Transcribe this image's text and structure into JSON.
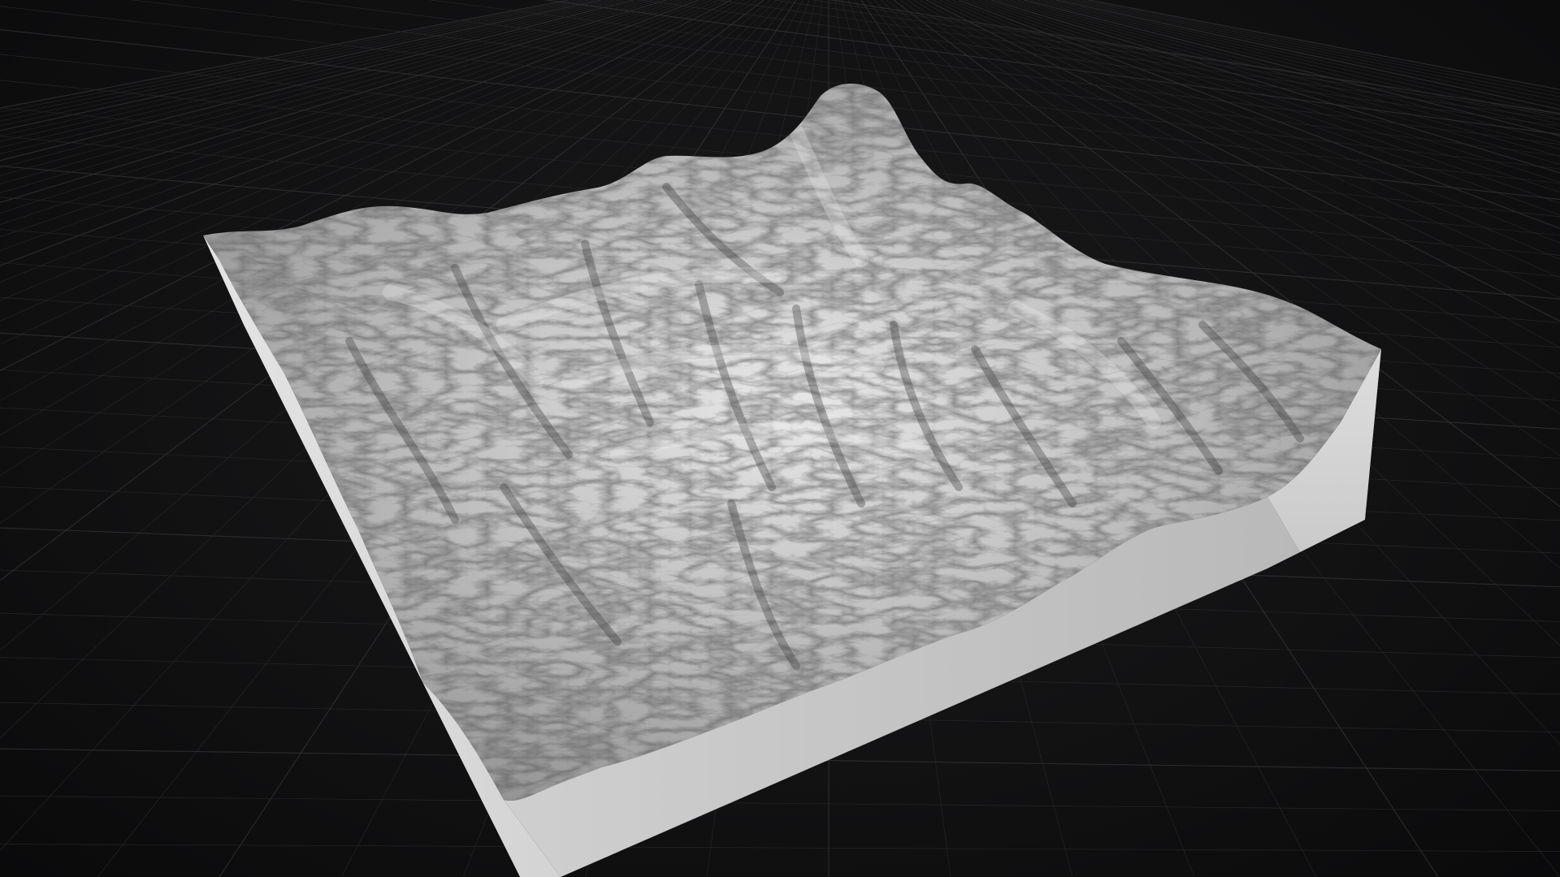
{
  "viewport": {
    "background_color": "#111112",
    "grid_color": "#2a2a2c",
    "grid_major_color": "#333336",
    "grid_visible": true
  },
  "terrain": {
    "surface_color": "#c8c8c8",
    "shadow_color": "#3a3a3a",
    "base_side_light": "#d9d9d9",
    "base_side_dark": "#bdbdbd",
    "shading": "hillshade-grayscale"
  }
}
